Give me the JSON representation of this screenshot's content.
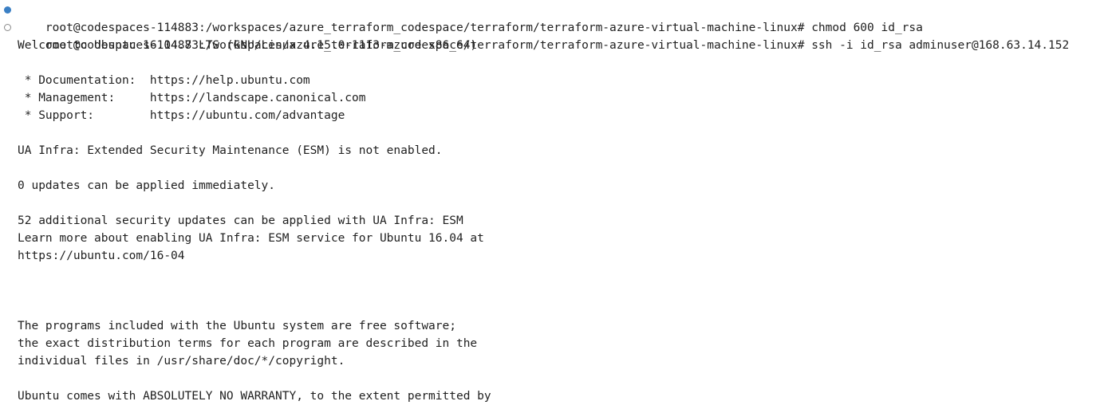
{
  "terminal": {
    "lines": [
      {
        "marker": "filled",
        "text": "root@codespaces-114883:/workspaces/azure_terraform_codespace/terraform/terraform-azure-virtual-machine-linux# chmod 600 id_rsa"
      },
      {
        "marker": "hollow",
        "text": "root@codespaces-114883:/workspaces/azure_terraform_codespace/terraform/terraform-azure-virtual-machine-linux# ssh -i id_rsa adminuser@168.63.14.152"
      },
      {
        "marker": "",
        "text": "Welcome to Ubuntu 16.04.7 LTS (GNU/Linux 4.15.0-1113-azure x86_64)"
      },
      {
        "marker": "",
        "text": ""
      },
      {
        "marker": "",
        "text": " * Documentation:  https://help.ubuntu.com"
      },
      {
        "marker": "",
        "text": " * Management:     https://landscape.canonical.com"
      },
      {
        "marker": "",
        "text": " * Support:        https://ubuntu.com/advantage"
      },
      {
        "marker": "",
        "text": ""
      },
      {
        "marker": "",
        "text": "UA Infra: Extended Security Maintenance (ESM) is not enabled."
      },
      {
        "marker": "",
        "text": ""
      },
      {
        "marker": "",
        "text": "0 updates can be applied immediately."
      },
      {
        "marker": "",
        "text": ""
      },
      {
        "marker": "",
        "text": "52 additional security updates can be applied with UA Infra: ESM"
      },
      {
        "marker": "",
        "text": "Learn more about enabling UA Infra: ESM service for Ubuntu 16.04 at"
      },
      {
        "marker": "",
        "text": "https://ubuntu.com/16-04"
      },
      {
        "marker": "",
        "text": ""
      },
      {
        "marker": "",
        "text": ""
      },
      {
        "marker": "",
        "text": ""
      },
      {
        "marker": "",
        "text": "The programs included with the Ubuntu system are free software;"
      },
      {
        "marker": "",
        "text": "the exact distribution terms for each program are described in the"
      },
      {
        "marker": "",
        "text": "individual files in /usr/share/doc/*/copyright."
      },
      {
        "marker": "",
        "text": ""
      },
      {
        "marker": "",
        "text": "Ubuntu comes with ABSOLUTELY NO WARRANTY, to the extent permitted by"
      }
    ],
    "colors": {
      "background": "#ffffff",
      "text": "#1f1f1f",
      "success_marker": "#3a7fc4",
      "pending_marker": "#8a8a8a"
    }
  }
}
